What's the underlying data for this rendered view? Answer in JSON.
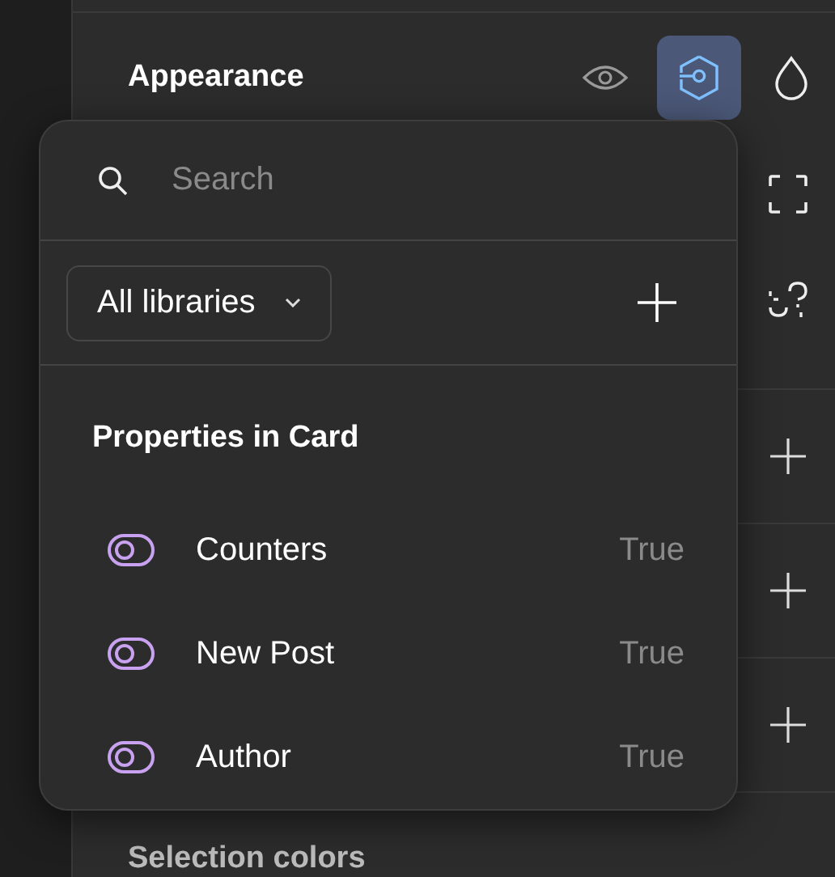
{
  "panel": {
    "section_title": "Appearance",
    "header_actions": [
      {
        "kind": "visibility",
        "selected": false
      },
      {
        "kind": "component",
        "selected": true
      }
    ],
    "next_section": "Selection colors"
  },
  "popover": {
    "search": {
      "placeholder": "Search"
    },
    "library_filter": "All libraries",
    "group_title": "Properties in Card",
    "properties": [
      {
        "name": "Counters",
        "value": "True"
      },
      {
        "name": "New Post",
        "value": "True"
      },
      {
        "name": "Author",
        "value": "True"
      }
    ]
  }
}
